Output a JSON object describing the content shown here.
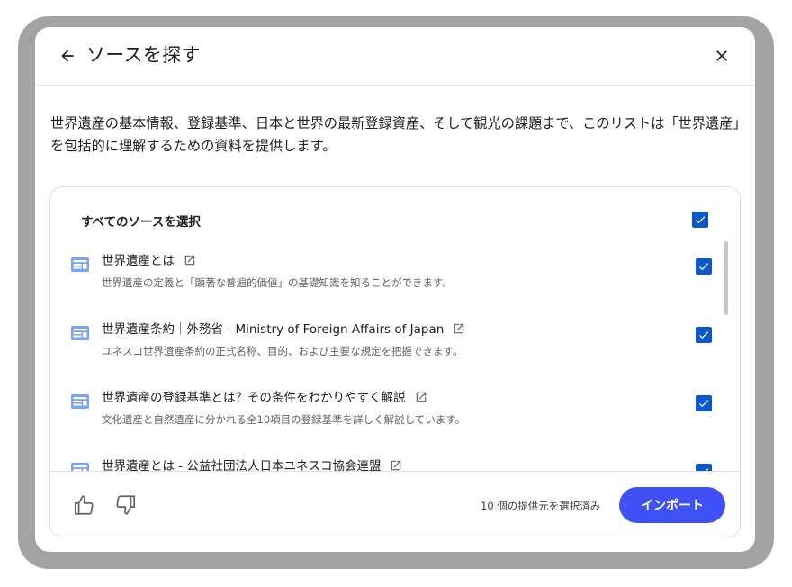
{
  "dialog": {
    "title": "ソースを探す",
    "description": "世界遺産の基本情報、登録基準、日本と世界の最新登録資産、そして観光の課題まで、このリストは「世界遺産」を包括的に理解するための資料を提供します。"
  },
  "sources": {
    "select_all_label": "すべてのソースを選択",
    "select_all_checked": true,
    "items": [
      {
        "title": "世界遺産とは",
        "description": "世界遺産の定義と「顕著な普遍的価値」の基礎知識を知ることができます。",
        "checked": true,
        "icon": "web-source-icon"
      },
      {
        "title": "世界遺産条約｜外務省 - Ministry of Foreign Affairs of Japan",
        "description": "ユネスコ世界遺産条約の正式名称、目的、および主要な規定を把握できます。",
        "checked": true,
        "icon": "web-source-icon"
      },
      {
        "title": "世界遺産の登録基準とは？その条件をわかりやすく解説",
        "description": "文化遺産と自然遺産に分かれる全10項目の登録基準を詳しく解説しています。",
        "checked": true,
        "icon": "web-source-icon"
      },
      {
        "title": "世界遺産とは - 公益社団法人日本ユネスコ協会連盟",
        "description": "",
        "checked": true,
        "icon": "web-source-icon"
      }
    ]
  },
  "footer": {
    "selected_count": "10 個の提供元を選択済み",
    "import_label": "インポート"
  },
  "colors": {
    "accent": "#0b57d0",
    "import_button": "#3f51f4",
    "source_icon": "#7aa4f0"
  }
}
